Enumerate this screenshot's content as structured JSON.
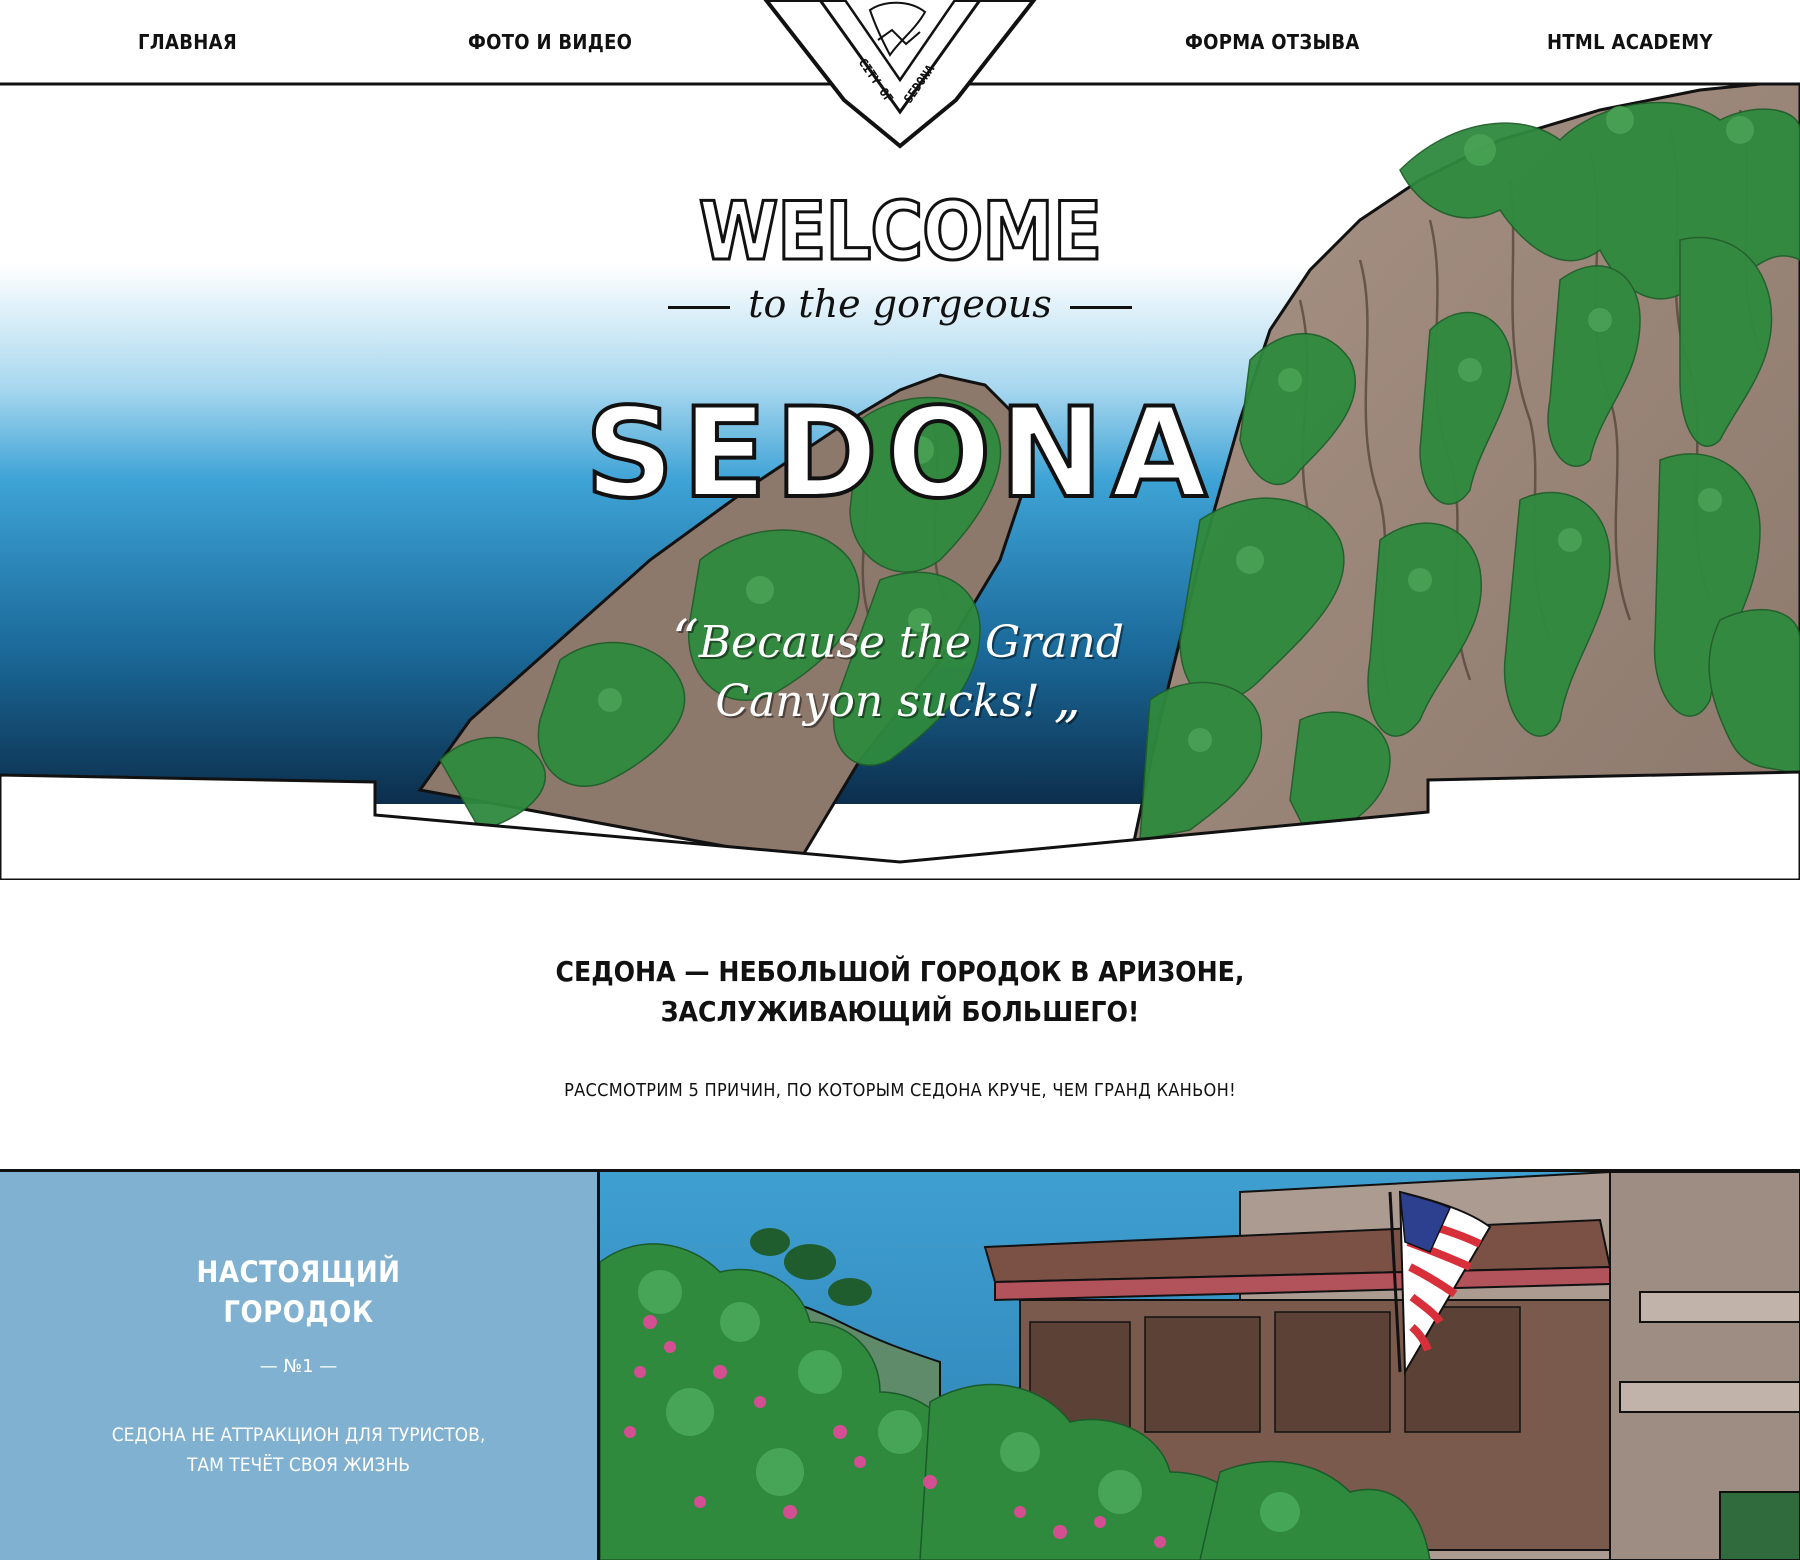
{
  "nav": {
    "home": "главная",
    "photo_video": "фото и видео",
    "feedback": "форма отзыва",
    "academy": "HTML Academy"
  },
  "logo": {
    "text_top": "CITY OF",
    "text_bottom": "SEDONA",
    "icon": "city-emblem-icon"
  },
  "hero": {
    "welcome": "WELCOME",
    "subtitle": "to the gorgeous",
    "city": "SEDONA",
    "tagline_line1": "Because the Grand",
    "tagline_line2": "Canyon sucks!"
  },
  "intro": {
    "title_line1": "Седона — небольшой городок в Аризоне,",
    "title_line2": "заслуживающий большего!",
    "text": "Рассмотрим 5 причин, по которым Седона круче, чем Гранд Каньон!"
  },
  "feature": {
    "title_line1": "Настоящий",
    "title_line2": "городок",
    "number": "— №1 —",
    "text_line1": "Седона не аттракцион для туристов,",
    "text_line2": "там течёт своя жизнь"
  },
  "colors": {
    "panel_blue": "#81b1d1",
    "sky_top": "#4fb0dc",
    "sky_bottom": "#0e3557",
    "rock": "#9e8a7e",
    "foliage": "#2f8a3e"
  }
}
